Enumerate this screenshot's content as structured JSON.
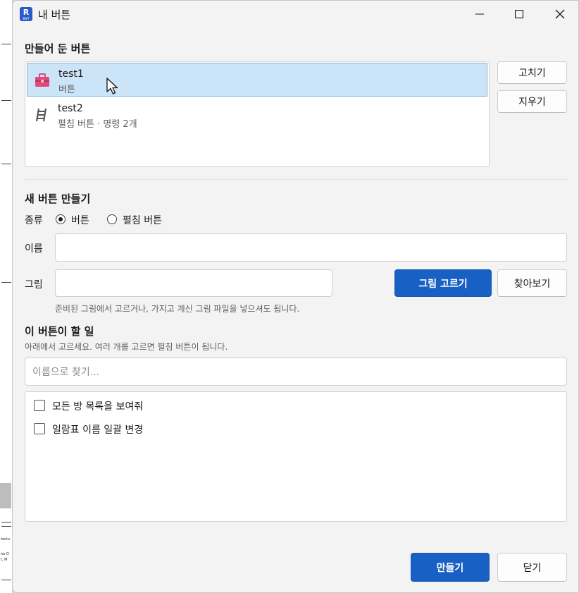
{
  "window": {
    "title": "내 버튼",
    "app_icon_letter": "R",
    "app_icon_sub": "RVT",
    "controls": [
      "minimize-icon",
      "maximize-icon",
      "close-icon"
    ]
  },
  "saved": {
    "heading": "만들어 둔 버튼",
    "items": [
      {
        "name": "test1",
        "subtitle": "버튼",
        "icon": "toolbox-icon",
        "selected": true
      },
      {
        "name": "test2",
        "subtitle": "펼침 버튼 · 명령 2개",
        "icon": "ladder-icon",
        "selected": false
      }
    ],
    "edit_label": "고치기",
    "delete_label": "지우기"
  },
  "create": {
    "heading": "새 버튼 만들기",
    "kind_label": "종류",
    "kind_options": [
      {
        "label": "버튼",
        "selected": true
      },
      {
        "label": "펼침 버튼",
        "selected": false
      }
    ],
    "name_label": "이름",
    "name_value": "",
    "image_label": "그림",
    "image_value": "",
    "pick_image_label": "그림 고르기",
    "browse_label": "찾아보기",
    "image_hint": "준비된 그림에서 고르거나, 가지고 계신 그림 파일을 넣으셔도 됩니다."
  },
  "actions": {
    "heading": "이 버튼이 할 일",
    "hint": "아래에서 고르세요. 여러 개를 고르면 펼침 버튼이 됩니다.",
    "search_placeholder": "이름으로 찾기...",
    "commands": [
      {
        "label": "모든 방 목록을 보여줘",
        "checked": false
      },
      {
        "label": "일람표 이름 일괄 변경",
        "checked": false
      }
    ]
  },
  "footer": {
    "create_label": "만들기",
    "close_label": "닫기"
  },
  "colors": {
    "primary": "#1960c5",
    "selection": "#cce4f7",
    "window_bg": "#f3f3f3",
    "toolbox_icon": "#e04a7a"
  },
  "background_text": [
    "tectu",
    "ne O",
    "t, M"
  ]
}
